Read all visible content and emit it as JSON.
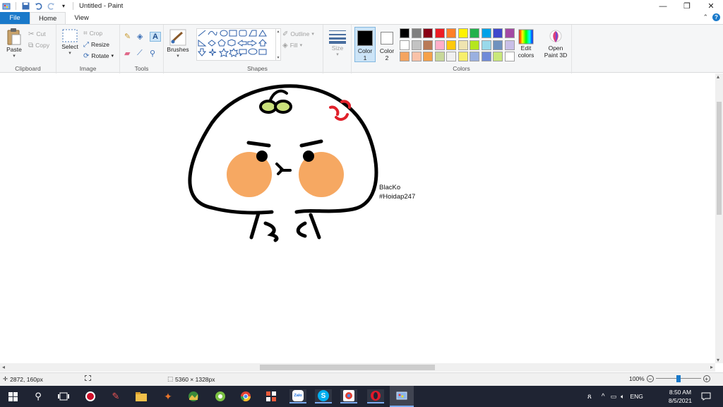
{
  "window": {
    "title": "Untitled - Paint",
    "minimize": "—",
    "maximize": "❐",
    "close": "✕"
  },
  "tabs": {
    "file": "File",
    "home": "Home",
    "view": "View"
  },
  "ribbon": {
    "clipboard": {
      "label": "Clipboard",
      "paste": "Paste",
      "cut": "Cut",
      "copy": "Copy"
    },
    "image": {
      "label": "Image",
      "select": "Select",
      "crop": "Crop",
      "resize": "Resize",
      "rotate": "Rotate"
    },
    "tools": {
      "label": "Tools"
    },
    "brushes": {
      "label": "Brushes"
    },
    "shapes": {
      "label": "Shapes",
      "outline": "Outline",
      "fill": "Fill"
    },
    "size": {
      "label": "Size"
    },
    "colors": {
      "label": "Colors",
      "color1_line1": "Color",
      "color1_line2": "1",
      "color2_line1": "Color",
      "color2_line2": "2",
      "edit_line1": "Edit",
      "edit_line2": "colors",
      "paint3d_line1": "Open",
      "paint3d_line2": "Paint 3D",
      "color1_value": "#000000",
      "color2_value": "#ffffff",
      "palette_row1": [
        "#000000",
        "#7f7f7f",
        "#880015",
        "#ed1c24",
        "#ff7f27",
        "#fff200",
        "#22b14c",
        "#00a2e8",
        "#3f48cc",
        "#a349a4"
      ],
      "palette_row2": [
        "#ffffff",
        "#c3c3c3",
        "#b97a57",
        "#ffaec9",
        "#ffc90e",
        "#efe4b0",
        "#b5e61d",
        "#99d9ea",
        "#7092be",
        "#c8bfe7"
      ],
      "palette_row3": [
        "#f4a460",
        "#f9c2a8",
        "#f5a14a",
        "#c8d89a",
        "#f0f0f0",
        "#f7ef6a",
        "#9ab0e0",
        "#6f8ad8",
        "#c9e87a",
        "#ffffff"
      ]
    }
  },
  "canvas": {
    "signature_line1": "BlacKo",
    "signature_line2": "#Hoidap247"
  },
  "status": {
    "cursor": "2872, 160px",
    "size": "5360 × 1328px",
    "zoom": "100%"
  },
  "taskbar": {
    "lang": "ENG",
    "time": "8:50 AM",
    "date": "8/5/2021",
    "zalo": "Zalo"
  }
}
